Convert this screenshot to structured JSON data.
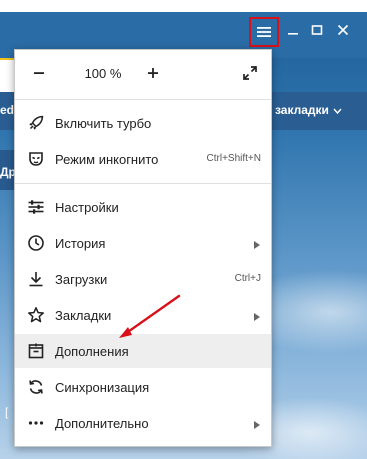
{
  "colors": {
    "accent_red": "#d7101a",
    "titlebar_blue": "#2a6ca6",
    "menu_bg": "#ffffff",
    "highlight": "#eeeeee"
  },
  "background": {
    "bookmarks_left_fragment": "ed",
    "tab_fragment": "Др",
    "bookmarks_right_label": "закладки",
    "bracket": "["
  },
  "window_controls": {
    "menu_icon": "hamburger-icon",
    "minimize_icon": "minimize-icon",
    "maximize_icon": "maximize-icon",
    "close_icon": "close-icon"
  },
  "menu": {
    "zoom": {
      "minus": "−",
      "value": "100 %",
      "plus": "+",
      "fullscreen_icon": "fullscreen-icon"
    },
    "items": [
      {
        "label": "Включить турбо",
        "shortcut": "",
        "has_submenu": false,
        "icon": "rocket-icon"
      },
      {
        "label": "Режим инкогнито",
        "shortcut": "Ctrl+Shift+N",
        "has_submenu": false,
        "icon": "incognito-mask-icon"
      },
      {
        "label": "Настройки",
        "shortcut": "",
        "has_submenu": false,
        "icon": "settings-sliders-icon"
      },
      {
        "label": "История",
        "shortcut": "",
        "has_submenu": true,
        "icon": "clock-icon"
      },
      {
        "label": "Загрузки",
        "shortcut": "Ctrl+J",
        "has_submenu": false,
        "icon": "download-icon"
      },
      {
        "label": "Закладки",
        "shortcut": "",
        "has_submenu": true,
        "icon": "star-icon"
      },
      {
        "label": "Дополнения",
        "shortcut": "",
        "has_submenu": false,
        "icon": "extensions-icon",
        "highlighted": true
      },
      {
        "label": "Синхронизация",
        "shortcut": "",
        "has_submenu": false,
        "icon": "sync-icon"
      },
      {
        "label": "Дополнительно",
        "shortcut": "",
        "has_submenu": true,
        "icon": "more-dots-icon"
      }
    ]
  }
}
